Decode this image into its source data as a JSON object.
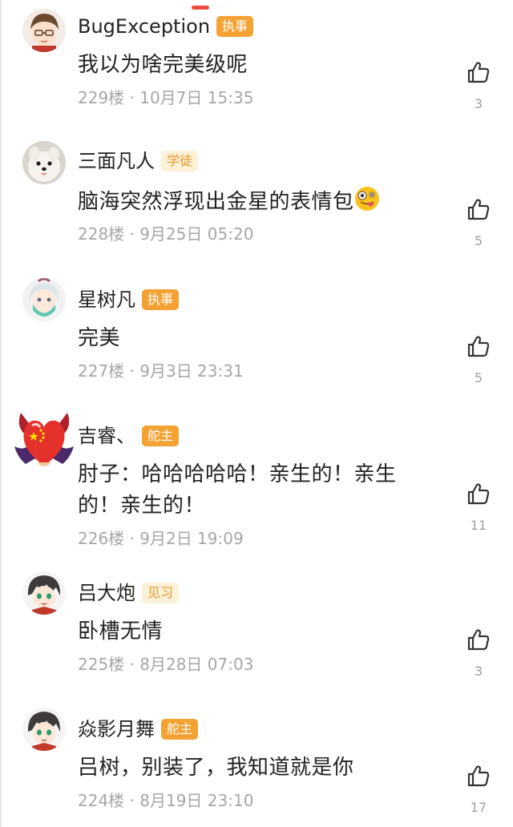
{
  "comments": [
    {
      "username": "BugException",
      "badge": "执事",
      "text": "我以为啥完美级呢",
      "meta": "229楼 · 10月7日 15:35",
      "likes": "3"
    },
    {
      "username": "三面凡人",
      "badge": "学徒",
      "text": "脑海突然浮现出金星的表情包",
      "meta": "228楼 · 9月25日 05:20",
      "likes": "5"
    },
    {
      "username": "星树凡",
      "badge": "执事",
      "text": "完美",
      "meta": "227楼 · 9月3日 23:31",
      "likes": "5"
    },
    {
      "username": "吉睿、",
      "badge": "舵主",
      "text": "肘子：哈哈哈哈哈！亲生的！亲生的！亲生的！",
      "meta": "226楼 · 9月2日 19:09",
      "likes": "11"
    },
    {
      "username": "吕大炮",
      "badge": "见习",
      "text": "卧槽无情",
      "meta": "225楼 · 8月28日 07:03",
      "likes": "3"
    },
    {
      "username": "焱影月舞",
      "badge": "舵主",
      "text": "吕树，别装了，我知道就是你",
      "meta": "224楼 · 8月19日 23:10",
      "likes": "17"
    }
  ],
  "colors": {
    "badge_orange": "#f5a234",
    "badge_light_bg": "#fdf1d8",
    "badge_light_text": "#e79a2a",
    "meta_gray": "#a6a6a6",
    "indicator_red": "#f04a3e"
  },
  "icons": {
    "like": "thumb-up-icon",
    "emoji": "crazy-face-emoji"
  }
}
